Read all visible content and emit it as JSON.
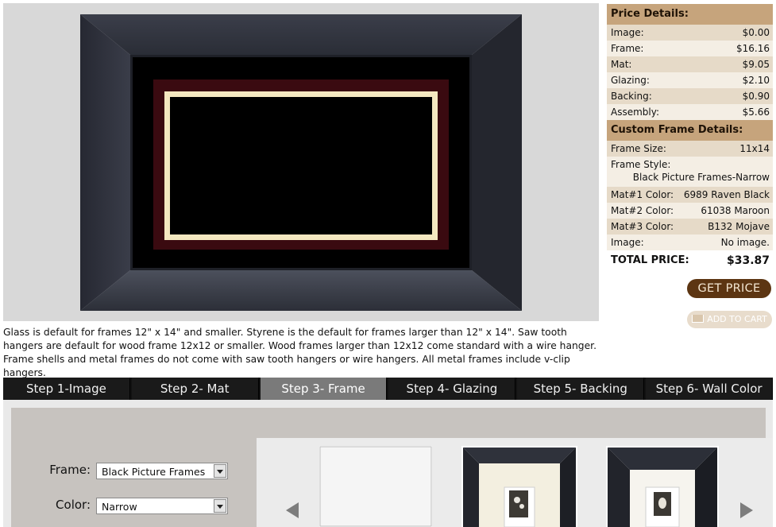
{
  "preview": {
    "notice": "Glass is default for frames 12\" x 14\" and smaller. Styrene is the default for frames larger than 12\" x 14\". Saw tooth hangers are default for wood frame 12x12 or smaller. Wood frames larger than 12x12 come standard with a wire hanger. Frame shells and metal frames do not come with saw tooth hangers or wire hangers. All metal frames include v-clip hangers."
  },
  "price_details": {
    "title": "Price Details:",
    "rows": [
      {
        "label": "Image:",
        "value": "$0.00"
      },
      {
        "label": "Frame:",
        "value": "$16.16"
      },
      {
        "label": "Mat:",
        "value": "$9.05"
      },
      {
        "label": "Glazing:",
        "value": "$2.10"
      },
      {
        "label": "Backing:",
        "value": "$0.90"
      },
      {
        "label": "Assembly:",
        "value": "$5.66"
      }
    ]
  },
  "custom_details": {
    "title": "Custom Frame Details:",
    "frame_size": {
      "label": "Frame Size:",
      "value": "11x14"
    },
    "frame_style": {
      "label": "Frame Style:",
      "value": "Black Picture Frames-Narrow"
    },
    "mat1": {
      "label": "Mat#1 Color:",
      "value": "6989 Raven Black"
    },
    "mat2": {
      "label": "Mat#2 Color:",
      "value": "61038 Maroon"
    },
    "mat3": {
      "label": "Mat#3 Color:",
      "value": "B132 Mojave"
    },
    "image": {
      "label": "Image:",
      "value": "No image."
    }
  },
  "total": {
    "label": "TOTAL PRICE:",
    "value": "$33.87"
  },
  "buttons": {
    "get_price": "GET PRICE",
    "add_to_cart": "ADD TO CART"
  },
  "steps": [
    {
      "label": "Step 1-Image"
    },
    {
      "label": "Step 2- Mat"
    },
    {
      "label": "Step 3- Frame",
      "active": true
    },
    {
      "label": "Step 4- Glazing"
    },
    {
      "label": "Step 5- Backing"
    },
    {
      "label": "Step 6- Wall Color"
    }
  ],
  "options": {
    "frame_label": "Frame:",
    "frame_value": "Black Picture Frames",
    "color_label": "Color:",
    "color_value": "Narrow"
  },
  "icons": {
    "cart": "cart-icon",
    "select_arrow": "chevron-down-icon",
    "gallery_prev": "arrow-left-icon",
    "gallery_next": "arrow-right-icon"
  },
  "colors": {
    "header_tan": "#c6a47c",
    "button_brown": "#5c3512",
    "step_active": "#7a7a7a",
    "mat_black": "#000000",
    "mat_maroon": "#3a0a10",
    "mat_mojave": "#f4e8c0"
  }
}
